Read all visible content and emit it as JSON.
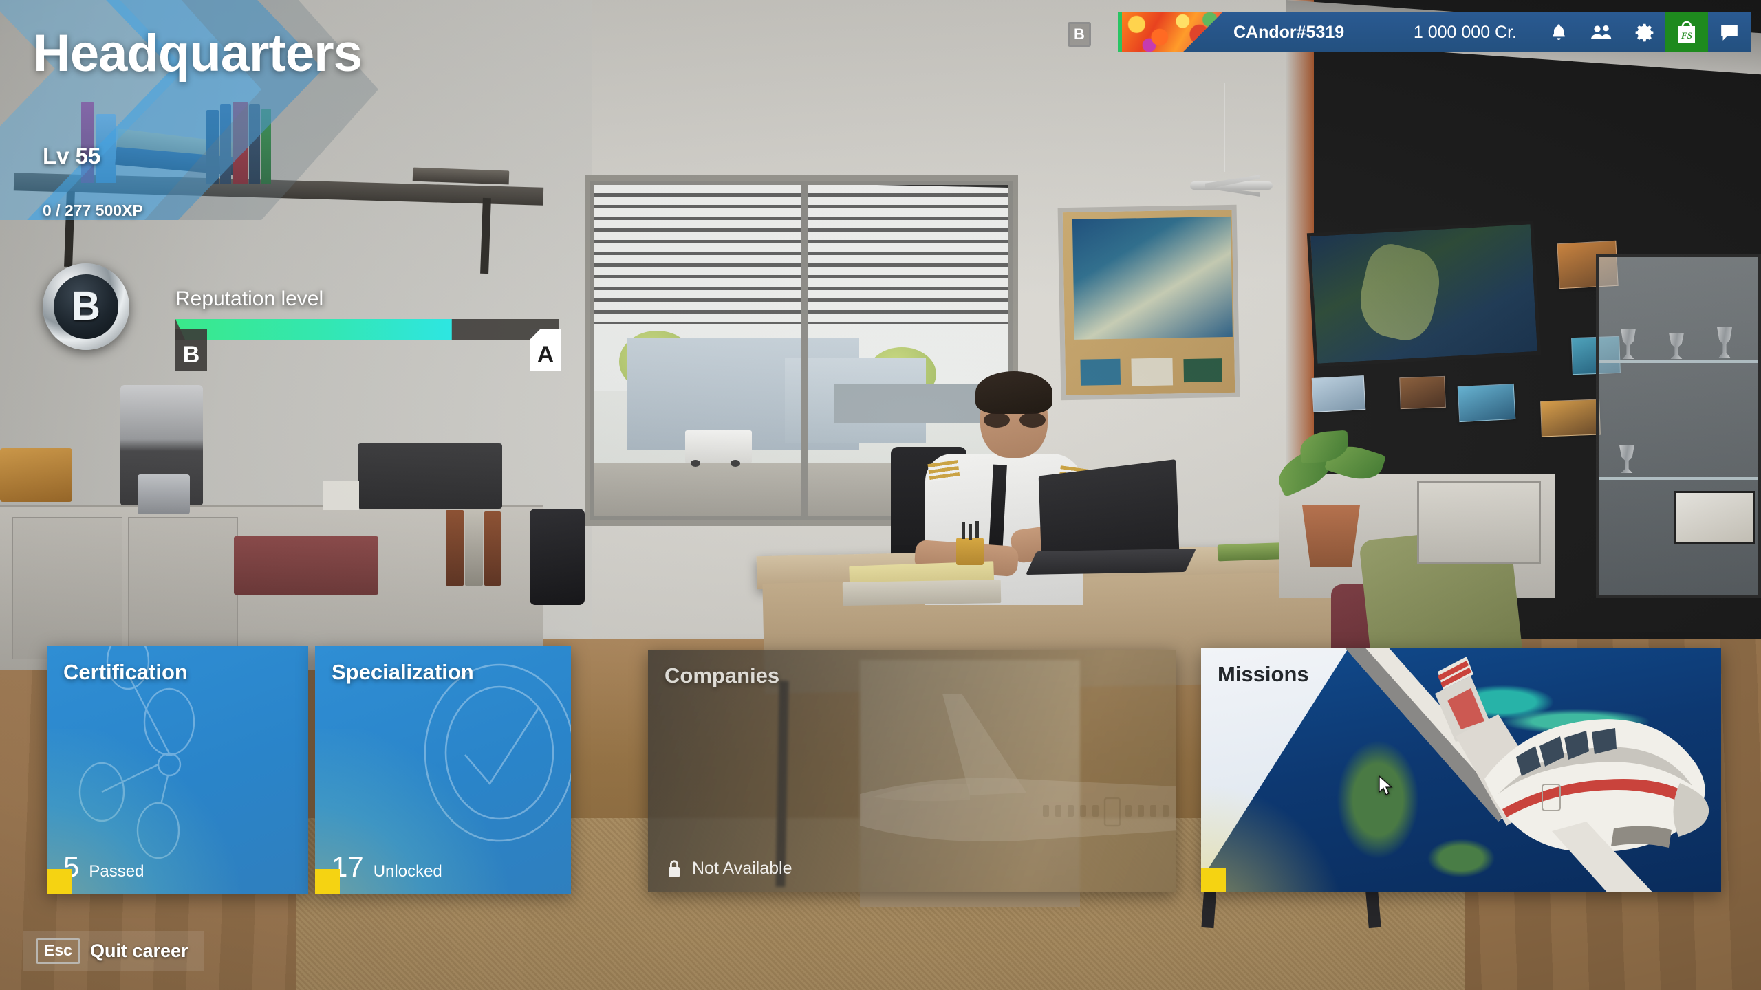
{
  "page": {
    "title": "Headquarters"
  },
  "progress": {
    "level_label": "Lv 55",
    "xp_label": "0 / 277 500XP",
    "rank_letter": "B",
    "reputation_label": "Reputation level",
    "reputation_percent": 72,
    "tier_current": "B",
    "tier_next": "A",
    "fill_color_start": "#3ae88a",
    "fill_color_end": "#2ee6e2"
  },
  "hud": {
    "key_hint": "B",
    "account_name": "CAndor#5319",
    "credits": "1 000 000 Cr.",
    "icons": [
      {
        "name": "notifications-icon",
        "label": "bell-icon"
      },
      {
        "name": "friends-icon",
        "label": "two-people-icon"
      },
      {
        "name": "settings-icon",
        "label": "gear-icon"
      },
      {
        "name": "marketplace-icon",
        "label": "fs-store-bag-icon",
        "text": "FS",
        "color": "#1e8a1e"
      },
      {
        "name": "messages-icon",
        "label": "chat-bubble-icon"
      }
    ]
  },
  "cards": [
    {
      "id": "certification",
      "title": "Certification",
      "count": "5",
      "status": "Passed",
      "locked": false,
      "style": "blue"
    },
    {
      "id": "specialization",
      "title": "Specialization",
      "count": "17",
      "status": "Unlocked",
      "locked": false,
      "style": "blue"
    },
    {
      "id": "companies",
      "title": "Companies",
      "count": "",
      "status": "Not Available",
      "locked": true,
      "style": "locked"
    },
    {
      "id": "missions",
      "title": "Missions",
      "count": "",
      "status": "",
      "locked": false,
      "style": "missions"
    }
  ],
  "footer": {
    "esc_key": "Esc",
    "esc_label": "Quit career"
  }
}
